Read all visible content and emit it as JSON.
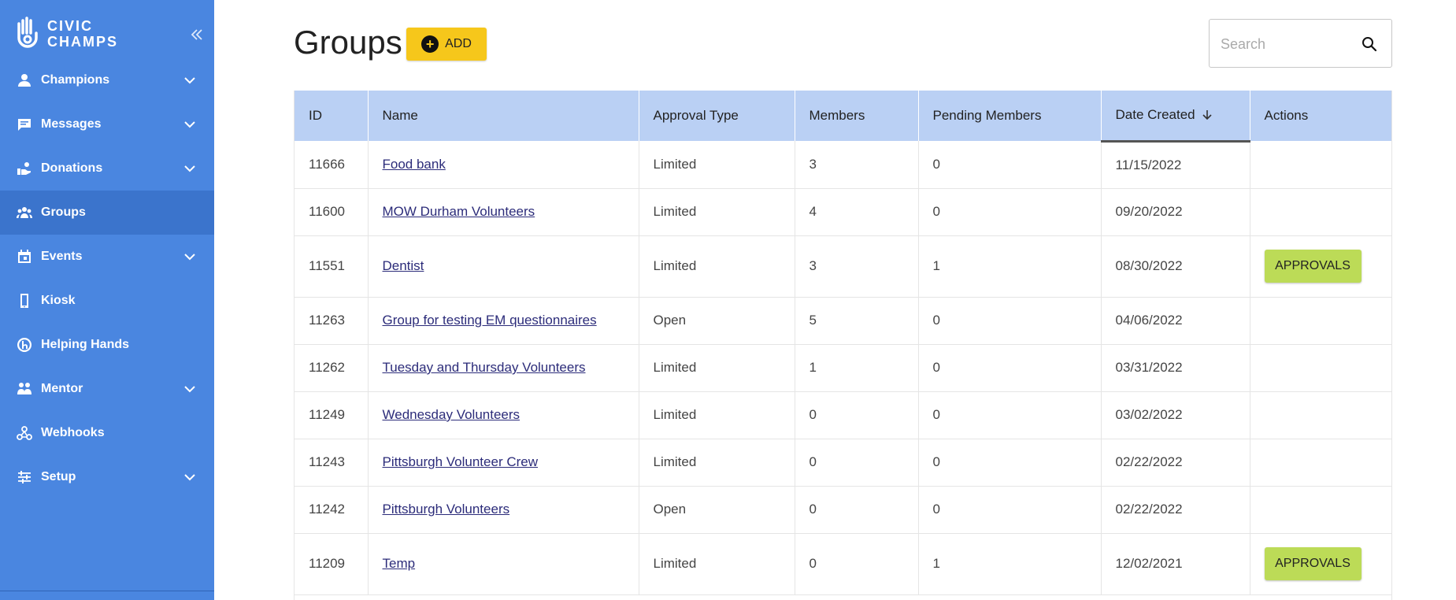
{
  "brand": {
    "line1": "CIVIC",
    "line2": "CHAMPS"
  },
  "sidebar": {
    "items": [
      {
        "label": "Champions",
        "icon": "person-icon",
        "has_chevron": true
      },
      {
        "label": "Messages",
        "icon": "message-icon",
        "has_chevron": true
      },
      {
        "label": "Donations",
        "icon": "donation-icon",
        "has_chevron": true
      },
      {
        "label": "Groups",
        "icon": "groups-icon",
        "has_chevron": false,
        "active": true
      },
      {
        "label": "Events",
        "icon": "calendar-icon",
        "has_chevron": true
      },
      {
        "label": "Kiosk",
        "icon": "phone-icon",
        "has_chevron": false
      },
      {
        "label": "Helping Hands",
        "icon": "helping-hands-icon",
        "has_chevron": false
      },
      {
        "label": "Mentor",
        "icon": "mentor-icon",
        "has_chevron": true
      },
      {
        "label": "Webhooks",
        "icon": "webhook-icon",
        "has_chevron": false
      },
      {
        "label": "Setup",
        "icon": "sliders-icon",
        "has_chevron": true
      }
    ]
  },
  "header": {
    "title": "Groups",
    "add_label": "ADD"
  },
  "search": {
    "placeholder": "Search"
  },
  "table": {
    "columns": [
      "ID",
      "Name",
      "Approval Type",
      "Members",
      "Pending Members",
      "Date Created",
      "Actions"
    ],
    "sorted_column": "Date Created",
    "rows": [
      {
        "id": "11666",
        "name": "Food bank",
        "approval": "Limited",
        "members": "3",
        "pending": "0",
        "date": "11/15/2022",
        "action": ""
      },
      {
        "id": "11600",
        "name": "MOW Durham Volunteers",
        "approval": "Limited",
        "members": "4",
        "pending": "0",
        "date": "09/20/2022",
        "action": ""
      },
      {
        "id": "11551",
        "name": "Dentist",
        "approval": "Limited",
        "members": "3",
        "pending": "1",
        "date": "08/30/2022",
        "action": "APPROVALS"
      },
      {
        "id": "11263",
        "name": "Group for testing EM questionnaires",
        "approval": "Open",
        "members": "5",
        "pending": "0",
        "date": "04/06/2022",
        "action": ""
      },
      {
        "id": "11262",
        "name": "Tuesday and Thursday Volunteers",
        "approval": "Limited",
        "members": "1",
        "pending": "0",
        "date": "03/31/2022",
        "action": ""
      },
      {
        "id": "11249",
        "name": "Wednesday Volunteers",
        "approval": "Limited",
        "members": "0",
        "pending": "0",
        "date": "03/02/2022",
        "action": ""
      },
      {
        "id": "11243",
        "name": "Pittsburgh Volunteer Crew",
        "approval": "Limited",
        "members": "0",
        "pending": "0",
        "date": "02/22/2022",
        "action": ""
      },
      {
        "id": "11242",
        "name": "Pittsburgh Volunteers",
        "approval": "Open",
        "members": "0",
        "pending": "0",
        "date": "02/22/2022",
        "action": ""
      },
      {
        "id": "11209",
        "name": "Temp",
        "approval": "Limited",
        "members": "0",
        "pending": "1",
        "date": "12/02/2021",
        "action": "APPROVALS"
      }
    ]
  },
  "colors": {
    "sidebar": "#4a86e0",
    "sidebar_active": "#3b74cc",
    "header_row": "#bad0f4",
    "add_button": "#f6c71b",
    "approvals_button": "#bcdb57"
  }
}
